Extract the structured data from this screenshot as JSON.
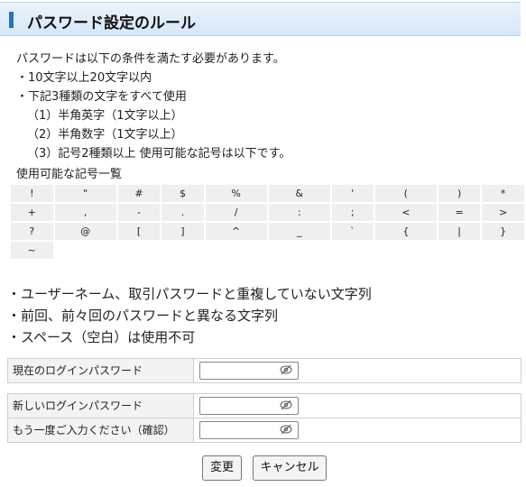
{
  "header": {
    "title": "パスワード設定のルール"
  },
  "rules": {
    "intro": "パスワードは以下の条件を満たす必要があります。",
    "lines": [
      "・10文字以上20文字以内",
      "・下記3種類の文字をすべて使用",
      "（1）半角英字（1文字以上）",
      "（2）半角数字（1文字以上）",
      "（3）記号2種類以上 使用可能な記号は以下です。"
    ]
  },
  "symbols": {
    "title": "使用可能な記号一覧",
    "rows": [
      [
        "!",
        "\"",
        "#",
        "$",
        "%",
        "&",
        "'",
        "(",
        ")",
        "*"
      ],
      [
        "+",
        ",",
        "-",
        ".",
        "/",
        ":",
        ";",
        "<",
        "=",
        ">"
      ],
      [
        "?",
        "@",
        "[",
        "]",
        "^",
        "_",
        "`",
        "{",
        "|",
        "}"
      ],
      [
        "~"
      ]
    ]
  },
  "notes": [
    "・ユーザーネーム、取引パスワードと重複していない文字列",
    "・前回、前々回のパスワードと異なる文字列",
    "・スペース（空白）は使用不可"
  ],
  "form": {
    "current_label": "現在のログインパスワード",
    "new_label": "新しいログインパスワード",
    "confirm_label": "もう一度ご入力ください（確認）"
  },
  "buttons": {
    "change": "変更",
    "cancel": "キャンセル"
  }
}
